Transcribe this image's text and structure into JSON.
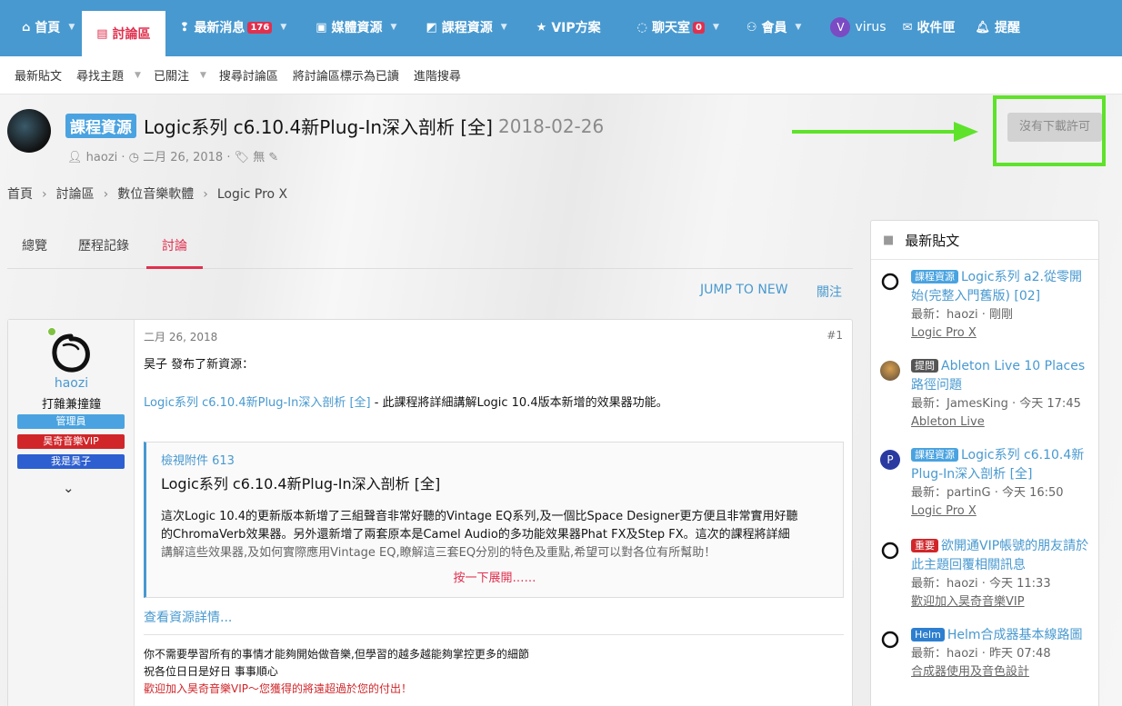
{
  "nav": {
    "tabs": [
      {
        "icon": "home-icon",
        "glyph": "⌂",
        "label": "首頁",
        "caret": true
      },
      {
        "icon": "forum-icon",
        "glyph": "▤",
        "label": "討論區",
        "active": true
      },
      {
        "icon": "news-icon",
        "glyph": "❢",
        "label": "最新消息",
        "badge": "176",
        "caret": true
      },
      {
        "icon": "media-icon",
        "glyph": "▣",
        "label": "媒體資源",
        "caret": true
      },
      {
        "icon": "resource-icon",
        "glyph": "◩",
        "label": "課程資源",
        "caret": true
      },
      {
        "icon": "star-icon",
        "glyph": "★",
        "label": "VIP方案"
      },
      {
        "icon": "chat-icon",
        "glyph": "◌",
        "label": "聊天室",
        "badge": "0",
        "caret": true
      },
      {
        "icon": "members-icon",
        "glyph": "⚇",
        "label": "會員",
        "caret": true
      }
    ],
    "user": {
      "avatar_letter": "V",
      "name": "virus"
    },
    "inbox": "收件匣",
    "alerts": "提醒"
  },
  "subnav": {
    "items": [
      "最新貼文",
      "尋找主題",
      "已關注",
      "搜尋討論區",
      "將討論區標示為已讀",
      "進階搜尋"
    ]
  },
  "thread": {
    "prefix": "課程資源",
    "title": "Logic系列 c6.10.4新Plug-In深入剖析 [全]",
    "date": "2018-02-26",
    "author": "haozi",
    "post_date": "二月 26, 2018",
    "tags": "無",
    "download_button": "沒有下載許可"
  },
  "breadcrumb": [
    "首頁",
    "討論區",
    "數位音樂軟體",
    "Logic Pro X"
  ],
  "tabs": [
    "總覽",
    "歷程記錄",
    "討論"
  ],
  "actions": {
    "jump": "JUMP TO NEW",
    "watch": "關注"
  },
  "post": {
    "user": {
      "name": "haozi",
      "title": "打雜兼撞鐘",
      "banners": [
        "管理員",
        "昊奇音樂VIP",
        "我是昊子"
      ]
    },
    "date": "二月 26, 2018",
    "number": "#1",
    "intro": "昊子 發布了新資源：",
    "link_text": "Logic系列 c6.10.4新Plug-In深入剖析 [全]",
    "link_suffix": " - 此課程將詳細講解Logic 10.4版本新增的效果器功能。",
    "attachment": {
      "view_label": "檢視附件 613",
      "title": "Logic系列 c6.10.4新Plug-In深入剖析 [全]",
      "desc_line1": "這次Logic 10.4的更新版本新增了三組聲音非常好聽的Vintage EQ系列,及一個比Space Designer更方便且非常實用好聽",
      "desc_line2": "的ChromaVerb效果器。另外還新增了兩套原本是Camel Audio的多功能效果器Phat FX及Step FX。這次的課程將詳細",
      "desc_line3": "講解這些效果器,及如何實際應用Vintage EQ,瞭解這三套EQ分別的特色及重點,希望可以對各位有所幫助！",
      "expand": "按一下展開……"
    },
    "more_link": "查看資源詳情...",
    "signature": {
      "line1": "你不需要學習所有的事情才能夠開始做音樂,但學習的越多越能夠掌控更多的細節",
      "line2": "祝各位日日是好日 事事順心",
      "line3": "歡迎加入昊奇音樂VIP～您獲得的將遠超過於您的付出！"
    }
  },
  "sidebar": {
    "title": "最新貼文",
    "items": [
      {
        "prefix": "課程資源",
        "prefix_color": "#4aa3e0",
        "title": "Logic系列 a2.從零開始(完整入門舊版) [02]",
        "meta": "最新：haozi · 剛剛",
        "forum": "Logic Pro X"
      },
      {
        "prefix": "提問",
        "prefix_color": "#555555",
        "title": "Ableton Live 10 Places 路徑问題",
        "meta": "最新：JamesKing · 今天 17:45",
        "forum": "Ableton Live"
      },
      {
        "prefix": "課程資源",
        "prefix_color": "#4aa3e0",
        "title": "Logic系列 c6.10.4新Plug-In深入剖析 [全]",
        "meta": "最新：partinG · 今天 16:50",
        "forum": "Logic Pro X",
        "avatar_letter": "P"
      },
      {
        "prefix": "重要",
        "prefix_color": "#d0262a",
        "title": "欲開通VIP帳號的朋友請於此主題回覆相關訊息",
        "meta": "最新：haozi · 今天 11:33",
        "forum": "歡迎加入昊奇音樂VIP"
      },
      {
        "prefix": "Helm",
        "prefix_color": "#2d7fd0",
        "title": "Helm合成器基本線路圖",
        "meta": "最新：haozi · 昨天 07:48",
        "forum": "合成器使用及音色設計"
      }
    ]
  },
  "colors": {
    "nav": "#4899d0",
    "accent": "#e0304e",
    "link": "#4899d0",
    "highlight": "#5ee32a"
  }
}
